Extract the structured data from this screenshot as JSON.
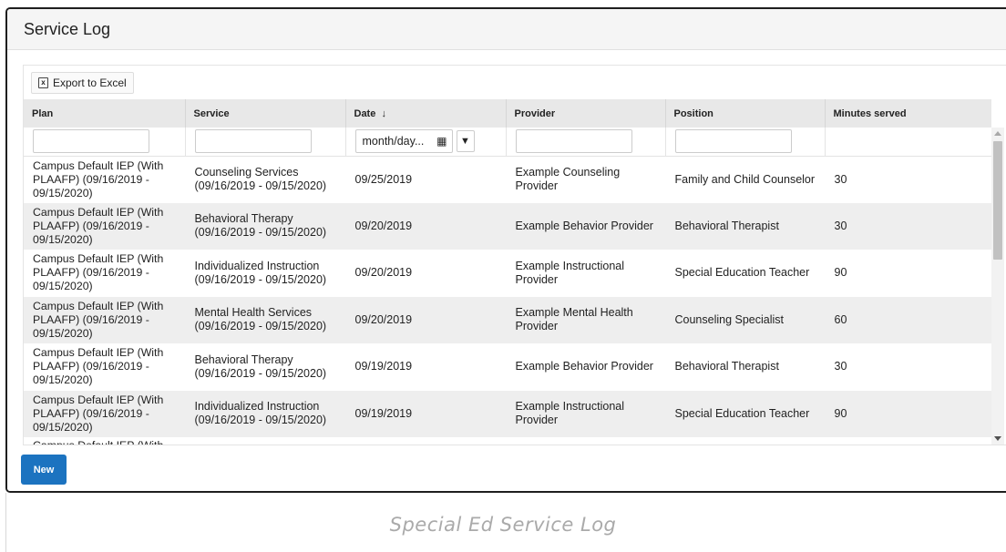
{
  "window": {
    "title": "Service Log"
  },
  "toolbar": {
    "export_label": "Export to Excel",
    "export_icon": "excel-icon"
  },
  "grid": {
    "columns": [
      {
        "label": "Plan"
      },
      {
        "label": "Service"
      },
      {
        "label": "Date",
        "sort": "↓"
      },
      {
        "label": "Provider"
      },
      {
        "label": "Position"
      },
      {
        "label": "Minutes served"
      }
    ],
    "date_filter_placeholder": "month/day...",
    "rows": [
      {
        "plan": "Campus Default IEP (With PLAAFP) (09/16/2019 - 09/15/2020)",
        "service": "Counseling Services (09/16/2019 - 09/15/2020)",
        "date": "09/25/2019",
        "provider": "Example Counseling Provider",
        "position": "Family and Child Counselor",
        "minutes": "30"
      },
      {
        "plan": "Campus Default IEP (With PLAAFP) (09/16/2019 - 09/15/2020)",
        "service": "Behavioral Therapy (09/16/2019 - 09/15/2020)",
        "date": "09/20/2019",
        "provider": "Example Behavior Provider",
        "position": "Behavioral Therapist",
        "minutes": "30"
      },
      {
        "plan": "Campus Default IEP (With PLAAFP) (09/16/2019 - 09/15/2020)",
        "service": "Individualized Instruction (09/16/2019 - 09/15/2020)",
        "date": "09/20/2019",
        "provider": "Example Instructional Provider",
        "position": "Special Education Teacher",
        "minutes": "90"
      },
      {
        "plan": "Campus Default IEP (With PLAAFP) (09/16/2019 - 09/15/2020)",
        "service": "Mental Health Services (09/16/2019 - 09/15/2020)",
        "date": "09/20/2019",
        "provider": "Example Mental Health Provider",
        "position": "Counseling Specialist",
        "minutes": "60"
      },
      {
        "plan": "Campus Default IEP (With PLAAFP) (09/16/2019 - 09/15/2020)",
        "service": "Behavioral Therapy (09/16/2019 - 09/15/2020)",
        "date": "09/19/2019",
        "provider": "Example Behavior Provider",
        "position": "Behavioral Therapist",
        "minutes": "30"
      },
      {
        "plan": "Campus Default IEP (With PLAAFP) (09/16/2019 - 09/15/2020)",
        "service": "Individualized Instruction (09/16/2019 - 09/15/2020)",
        "date": "09/19/2019",
        "provider": "Example Instructional Provider",
        "position": "Special Education Teacher",
        "minutes": "90"
      },
      {
        "plan": "Campus Default IEP (With",
        "service": "",
        "date": "",
        "provider": "",
        "position": "",
        "minutes": ""
      }
    ]
  },
  "footer": {
    "new_label": "New"
  },
  "caption": "Special Ed Service Log",
  "colors": {
    "primary_button": "#1c73c0",
    "header_bg": "#e8e8e8",
    "stripe_bg": "#eeeeee"
  }
}
